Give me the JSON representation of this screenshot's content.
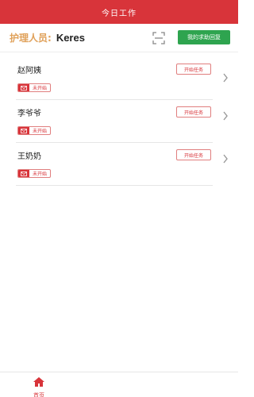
{
  "header": {
    "title": "今日工作"
  },
  "nurse": {
    "label": "护理人员:",
    "name": "Keres"
  },
  "help_button": {
    "label": "我的求助回复"
  },
  "list": {
    "items": [
      {
        "name": "赵阿姨",
        "status": "未开始",
        "action": "开始任务"
      },
      {
        "name": "李爷爷",
        "status": "未开始",
        "action": "开始任务"
      },
      {
        "name": "王奶奶",
        "status": "未开始",
        "action": "开始任务"
      }
    ]
  },
  "tabbar": {
    "home_label": "首页"
  },
  "colors": {
    "accent": "#d8343a",
    "help": "#2ea44f",
    "nurse_label": "#e0a15a"
  },
  "icons": {
    "scan": "scan-icon",
    "status": "envelope-icon",
    "chevron": "chevron-right-icon",
    "home": "home-icon"
  }
}
